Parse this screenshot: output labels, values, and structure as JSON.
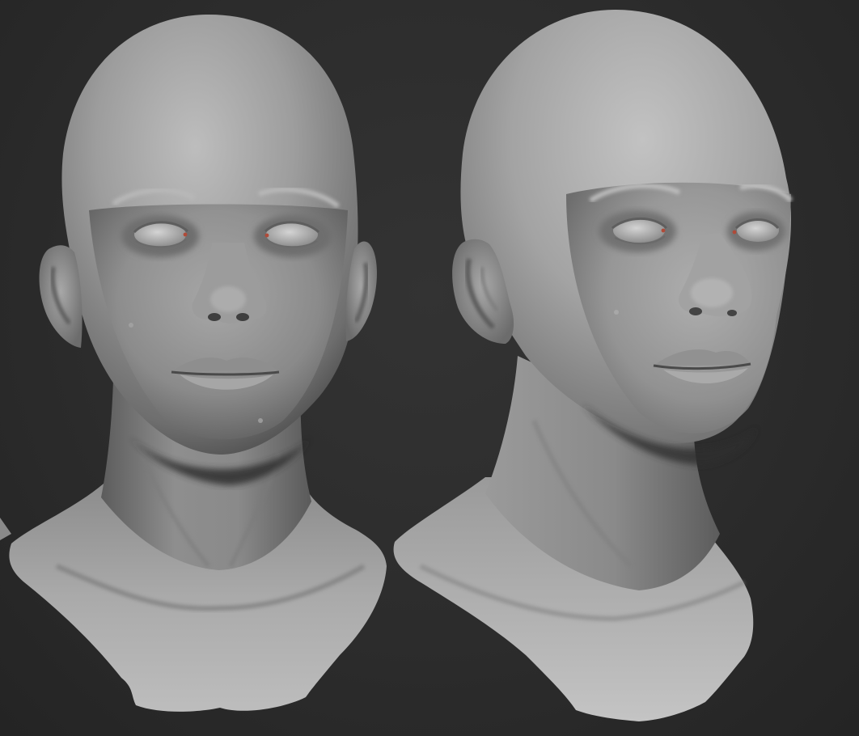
{
  "scene": {
    "background_color": "#2b2b2b",
    "material_color": "#9a9a9a",
    "caruncle_color": "#b04a38",
    "subjects": [
      {
        "id": "front",
        "view": "front"
      },
      {
        "id": "three-quarter",
        "view": "three-quarter"
      }
    ]
  }
}
